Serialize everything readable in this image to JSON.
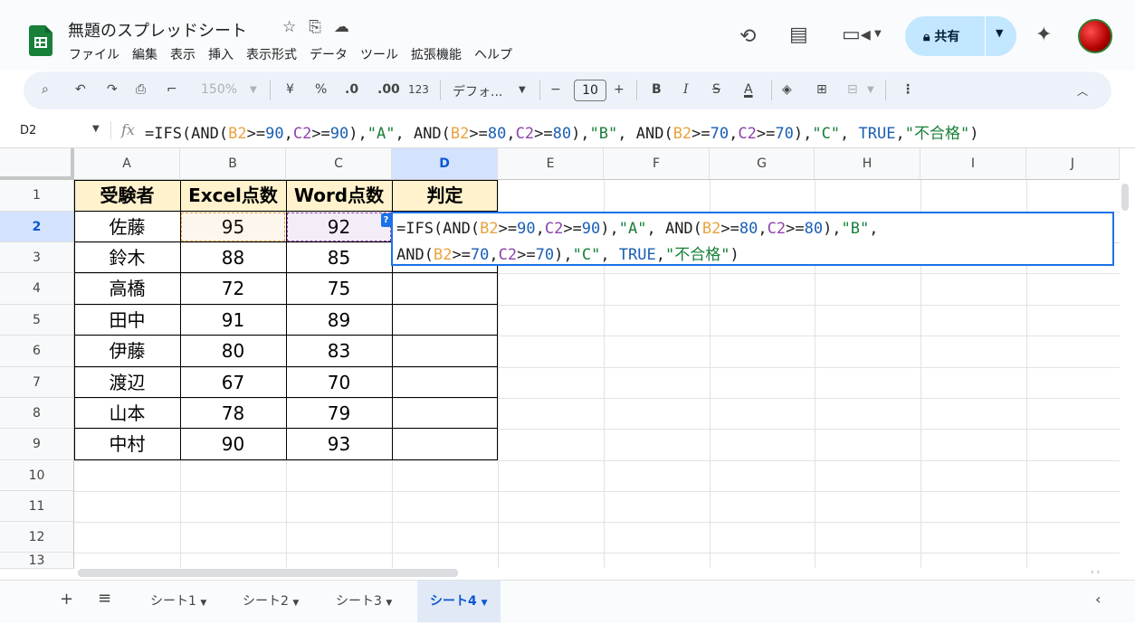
{
  "app": {
    "doc_title": "無題のスプレッドシート",
    "menu": [
      "ファイル",
      "編集",
      "表示",
      "挿入",
      "表示形式",
      "データ",
      "ツール",
      "拡張機能",
      "ヘルプ"
    ],
    "share_label": "共有"
  },
  "toolbar": {
    "zoom": "150%",
    "currency": "¥",
    "percent": "%",
    "dec_decrease": ".0",
    "dec_increase": ".00",
    "number_format": "123",
    "font_name": "デフォ...",
    "font_size": "10",
    "bold": "B",
    "italic": "I",
    "underline_color": "A"
  },
  "formula_bar": {
    "name_box": "D2",
    "formula": "=IFS(AND(B2>=90,C2>=90),\"A\", AND(B2>=80,C2>=80),\"B\", AND(B2>=70,C2>=70),\"C\", TRUE,\"不合格\")"
  },
  "grid": {
    "columns": [
      "A",
      "B",
      "C",
      "D",
      "E",
      "F",
      "G",
      "H",
      "I",
      "J"
    ],
    "selected_column": "D",
    "rows": [
      "1",
      "2",
      "3",
      "4",
      "5",
      "6",
      "7",
      "8",
      "9",
      "10",
      "11",
      "12",
      "13"
    ],
    "selected_row": "2",
    "headers": [
      "受験者",
      "Excel点数",
      "Word点数",
      "判定"
    ],
    "data": [
      [
        "佐藤",
        "95",
        "92"
      ],
      [
        "鈴木",
        "88",
        "85"
      ],
      [
        "高橋",
        "72",
        "75"
      ],
      [
        "田中",
        "91",
        "89"
      ],
      [
        "伊藤",
        "80",
        "83"
      ],
      [
        "渡辺",
        "67",
        "70"
      ],
      [
        "山本",
        "78",
        "79"
      ],
      [
        "中村",
        "90",
        "93"
      ]
    ]
  },
  "editor": {
    "line1": "=IFS(AND(B2>=90,C2>=90),\"A\", AND(B2>=80,C2>=80),\"B\",",
    "line2": "AND(B2>=70,C2>=70),\"C\", TRUE,\"不合格\")",
    "help_badge": "?"
  },
  "sheets": {
    "tabs": [
      "シート1",
      "シート2",
      "シート3",
      "シート4"
    ],
    "active": "シート4"
  },
  "colors": {
    "accent_blue": "#1a73e8",
    "header_fill": "#fff2cc",
    "share_bg": "#c2e7ff",
    "ref_b": "#e8a33d",
    "ref_c": "#8e44ad"
  }
}
